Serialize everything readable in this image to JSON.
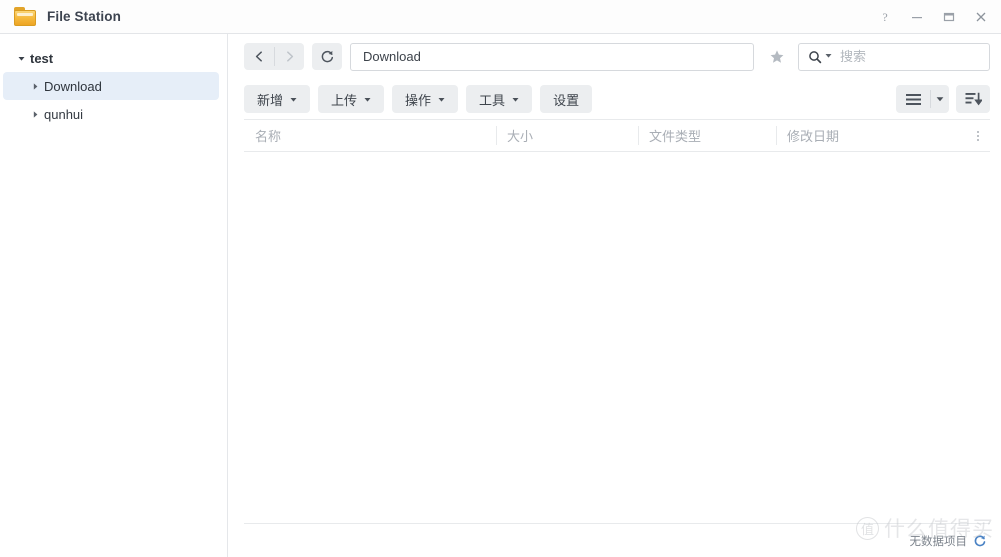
{
  "window": {
    "title": "File Station",
    "icon": "folder-icon",
    "controls": [
      {
        "name": "help-button",
        "glyph": "?"
      },
      {
        "name": "minimize-button",
        "glyph": "—"
      },
      {
        "name": "maximize-button",
        "glyph": "□"
      },
      {
        "name": "close-button",
        "glyph": "×"
      }
    ]
  },
  "sidebar": {
    "items": [
      {
        "label": "test",
        "level": "root",
        "expanded": true,
        "selected": false,
        "caret": "caret-down-icon"
      },
      {
        "label": "Download",
        "level": "child",
        "expanded": false,
        "selected": true,
        "caret": "caret-right-icon"
      },
      {
        "label": "qunhui",
        "level": "child",
        "expanded": false,
        "selected": false,
        "caret": "caret-right-icon"
      }
    ]
  },
  "navbar": {
    "back_label": "‹",
    "forward_label": "›",
    "back_name": "back-button",
    "forward_name": "forward-button",
    "forward_disabled": true,
    "refresh_name": "refresh-button",
    "path_value": "Download",
    "favorite_name": "favorite-star-icon",
    "favorite_glyph": "★",
    "search_placeholder": "搜索",
    "search_value": ""
  },
  "toolbar": {
    "buttons": [
      {
        "label": "新增",
        "name": "create-button",
        "has_caret": true
      },
      {
        "label": "上传",
        "name": "upload-button",
        "has_caret": true
      },
      {
        "label": "操作",
        "name": "action-button",
        "has_caret": true
      },
      {
        "label": "工具",
        "name": "tools-button",
        "has_caret": true
      },
      {
        "label": "设置",
        "name": "settings-button",
        "has_caret": false
      }
    ],
    "view_mode_name": "view-mode-button",
    "view_mode_caret": "chevron-down-icon",
    "sort_name": "sort-button"
  },
  "table": {
    "columns": [
      {
        "label": "名称",
        "name": "column-header-name"
      },
      {
        "label": "大小",
        "name": "column-header-size"
      },
      {
        "label": "文件类型",
        "name": "column-header-filetype"
      },
      {
        "label": "修改日期",
        "name": "column-header-modified-date"
      }
    ],
    "rows": [],
    "options_icon": "more-options-icon"
  },
  "statusbar": {
    "text": "无数据项目",
    "refresh_icon": "refresh-icon"
  },
  "watermark": {
    "badge": "值",
    "text": "什么值得买"
  },
  "colors": {
    "selection": "#e6eef8",
    "button_grey": "#eceef0",
    "accent_blue": "#4a82c4",
    "folder_orange": "#f6bb41"
  }
}
